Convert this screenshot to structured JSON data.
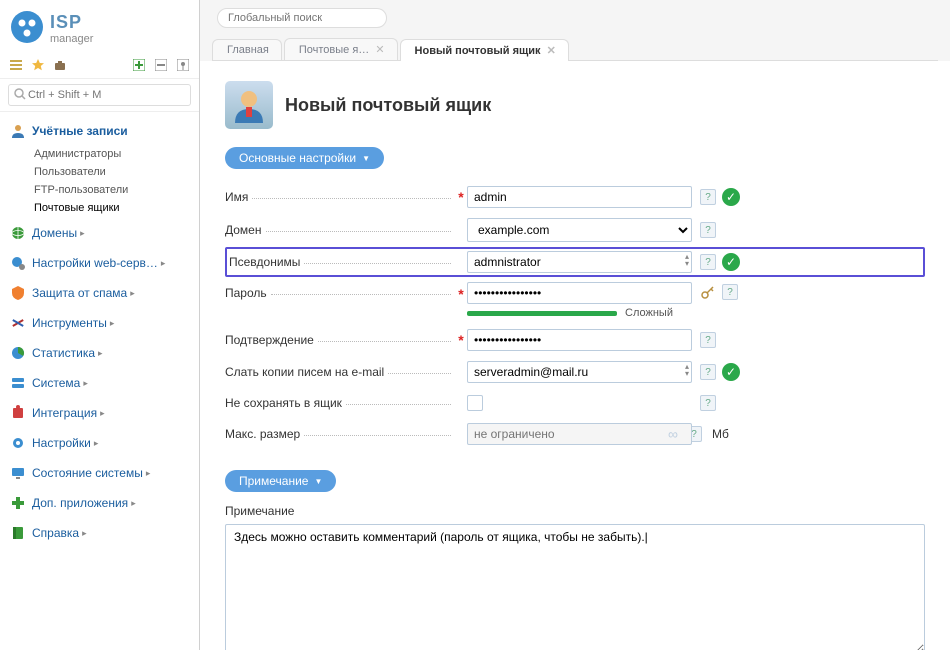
{
  "brand": {
    "isp": "ISP",
    "mgr": "manager"
  },
  "sidebar": {
    "search_placeholder": "Ctrl + Shift + M",
    "accounts": {
      "label": "Учётные записи",
      "items": [
        "Администраторы",
        "Пользователи",
        "FTP-пользователи",
        "Почтовые ящики"
      ]
    },
    "sections": [
      {
        "id": "domains",
        "label": "Домены"
      },
      {
        "id": "websettings",
        "label": "Настройки web-серв…"
      },
      {
        "id": "antispam",
        "label": "Защита от спама"
      },
      {
        "id": "tools",
        "label": "Инструменты"
      },
      {
        "id": "stats",
        "label": "Статистика"
      },
      {
        "id": "system",
        "label": "Система"
      },
      {
        "id": "integration",
        "label": "Интеграция"
      },
      {
        "id": "settings",
        "label": "Настройки"
      },
      {
        "id": "sysstate",
        "label": "Состояние системы"
      },
      {
        "id": "addons",
        "label": "Доп. приложения"
      },
      {
        "id": "help",
        "label": "Справка"
      }
    ]
  },
  "topbar": {
    "global_search_placeholder": "Глобальный поиск"
  },
  "tabs": [
    {
      "label": "Главная",
      "closable": false
    },
    {
      "label": "Почтовые я…",
      "closable": true
    },
    {
      "label": "Новый почтовый ящик",
      "closable": true,
      "active": true
    }
  ],
  "page": {
    "title": "Новый почтовый ящик"
  },
  "pill_main": "Основные настройки",
  "pill_note": "Примечание",
  "form": {
    "name_label": "Имя",
    "name_value": "admin",
    "domain_label": "Домен",
    "domain_value": "example.com",
    "aliases_label": "Псевдонимы",
    "aliases_value": "admnistrator",
    "password_label": "Пароль",
    "password_value": "••••••••••••••••",
    "password_strength": "Сложный",
    "confirm_label": "Подтверждение",
    "confirm_value": "••••••••••••••••",
    "copies_label": "Слать копии писем на e-mail",
    "copies_value": "serveradmin@mail.ru",
    "nosave_label": "Не сохранять в ящик",
    "maxsize_label": "Макс. размер",
    "maxsize_placeholder": "не ограничено",
    "maxsize_unit": "Мб"
  },
  "note": {
    "label": "Примечание",
    "value": "Здесь можно оставить комментарий (пароль от ящика, чтобы не забыть).|"
  }
}
